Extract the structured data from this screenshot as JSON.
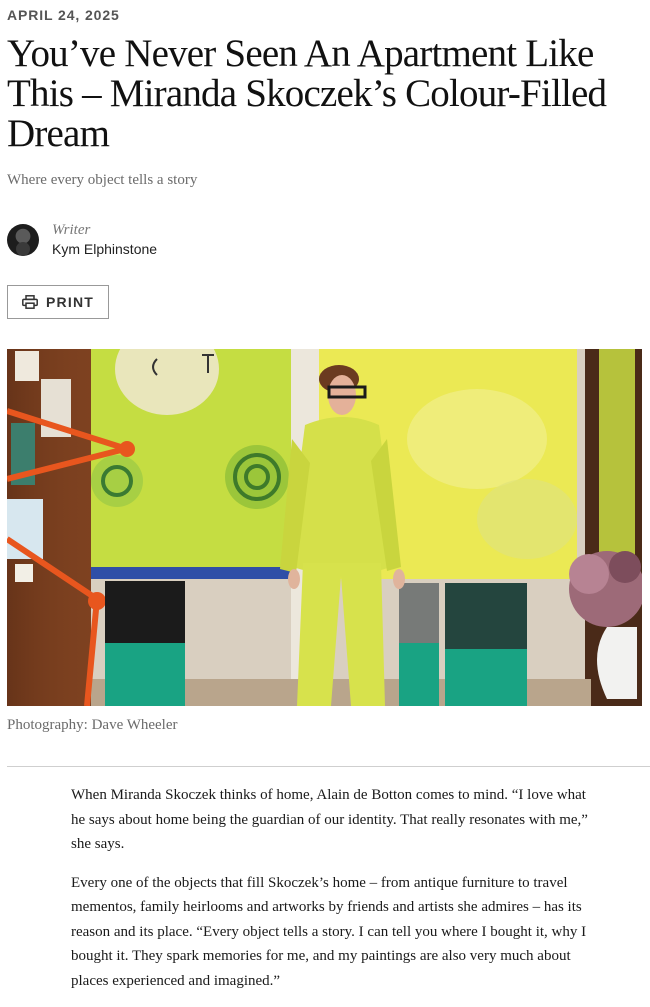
{
  "article": {
    "date": "APRIL 24, 2025",
    "headline": "You’ve Never Seen An Apartment Like This – Miranda Skoczek’s Colour-Filled Dream",
    "subtitle": "Where every object tells a story",
    "author": {
      "role": "Writer",
      "name": "Kym Elphinstone",
      "avatar_icon": "avatar-photo"
    },
    "print": {
      "label": "PRINT",
      "icon": "printer-icon"
    },
    "photo_credit": "Photography: Dave Wheeler",
    "paragraphs": [
      "When Miranda Skoczek thinks of home, Alain de Botton comes to mind. “I love what he says about home being the guardian of our identity. That really resonates with me,” she says.",
      "Every one of the objects that fill Skoczek’s home – from antique furniture to travel mementos, family heirlooms and artworks by friends and artists she admires – has its reason and its place. “Every object tells a story. I can tell you where I bought it, why I bought it. They spark memories for me, and my paintings are also very much about places experienced and imagined.”"
    ]
  },
  "colors": {
    "text": "#111111",
    "muted": "#6b6b6b",
    "border": "#999999",
    "divider": "#cfcfcf",
    "accent_lime": "#d6e13a"
  }
}
